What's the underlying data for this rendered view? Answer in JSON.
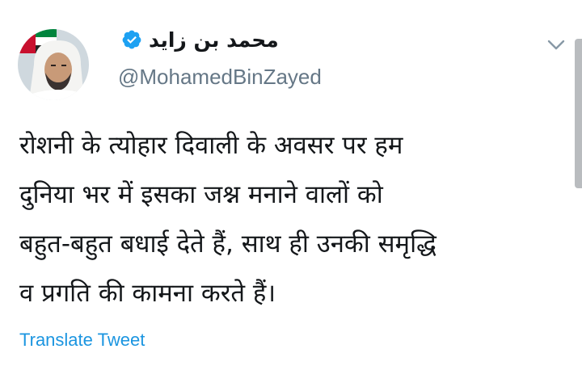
{
  "author": {
    "display_name": "محمد بن زايد",
    "handle": "@MohamedBinZayed",
    "verified": true
  },
  "tweet": {
    "lines": [
      "रोशनी के त्योहार दिवाली के अवसर पर हम",
      "दुनिया भर में इसका जश्न मनाने वालों को",
      "बहुत-बहुत बधाई देते हैं, साथ ही उनकी समृद्धि",
      "व प्रगति की कामना करते हैं।"
    ]
  },
  "actions": {
    "translate_label": "Translate Tweet",
    "menu_icon": "chevron-down-icon"
  },
  "colors": {
    "text": "#14171a",
    "secondary": "#657786",
    "link": "#1b95e0",
    "verified": "#1da1f2"
  }
}
